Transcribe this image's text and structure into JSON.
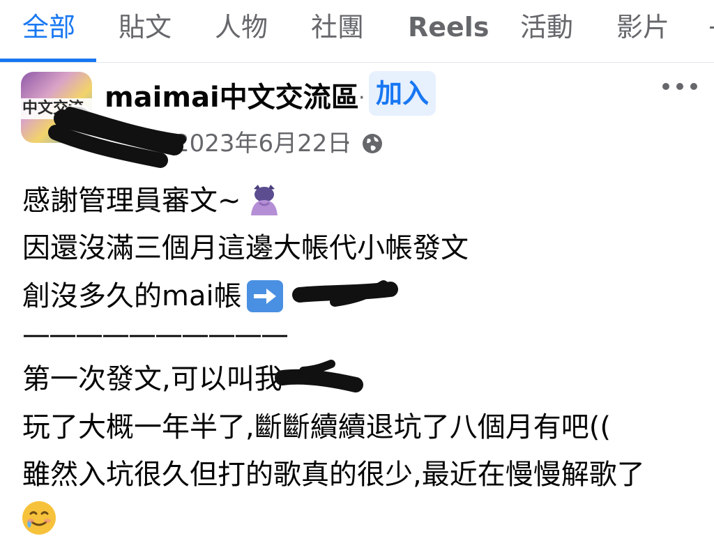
{
  "tabs": [
    {
      "label": "全部",
      "active": true
    },
    {
      "label": "貼文",
      "active": false
    },
    {
      "label": "人物",
      "active": false
    },
    {
      "label": "社團",
      "active": false
    },
    {
      "label": "Reels",
      "active": false
    },
    {
      "label": "活動",
      "active": false
    },
    {
      "label": "影片",
      "active": false
    }
  ],
  "post": {
    "group_name": "maimai中文交流區",
    "name_separator": "·",
    "join_label": "加入",
    "date": "2023年6月22日",
    "meta_separator": "·",
    "privacy_icon": "globe-icon",
    "avatar_text": "中文交流",
    "lines": [
      "感謝管理員審文~",
      "因還沒滿三個月這邊大帳代小帳發文",
      "創沒多久的mai帳",
      "——————————",
      "第一次發文,可以叫我",
      "玩了大概一年半了,斷斷續續退坑了八個月有吧((",
      "雖然入坑很久但打的歌真的很少,最近在慢慢解歌了"
    ],
    "emojis": [
      "person-bowing-emoji",
      "right-arrow-emoji",
      "smiling-face-with-tear-emoji"
    ]
  },
  "colors": {
    "accent": "#1877f2",
    "muted_text": "#65676b",
    "join_bg": "#e7f0fd",
    "text": "#050505"
  }
}
